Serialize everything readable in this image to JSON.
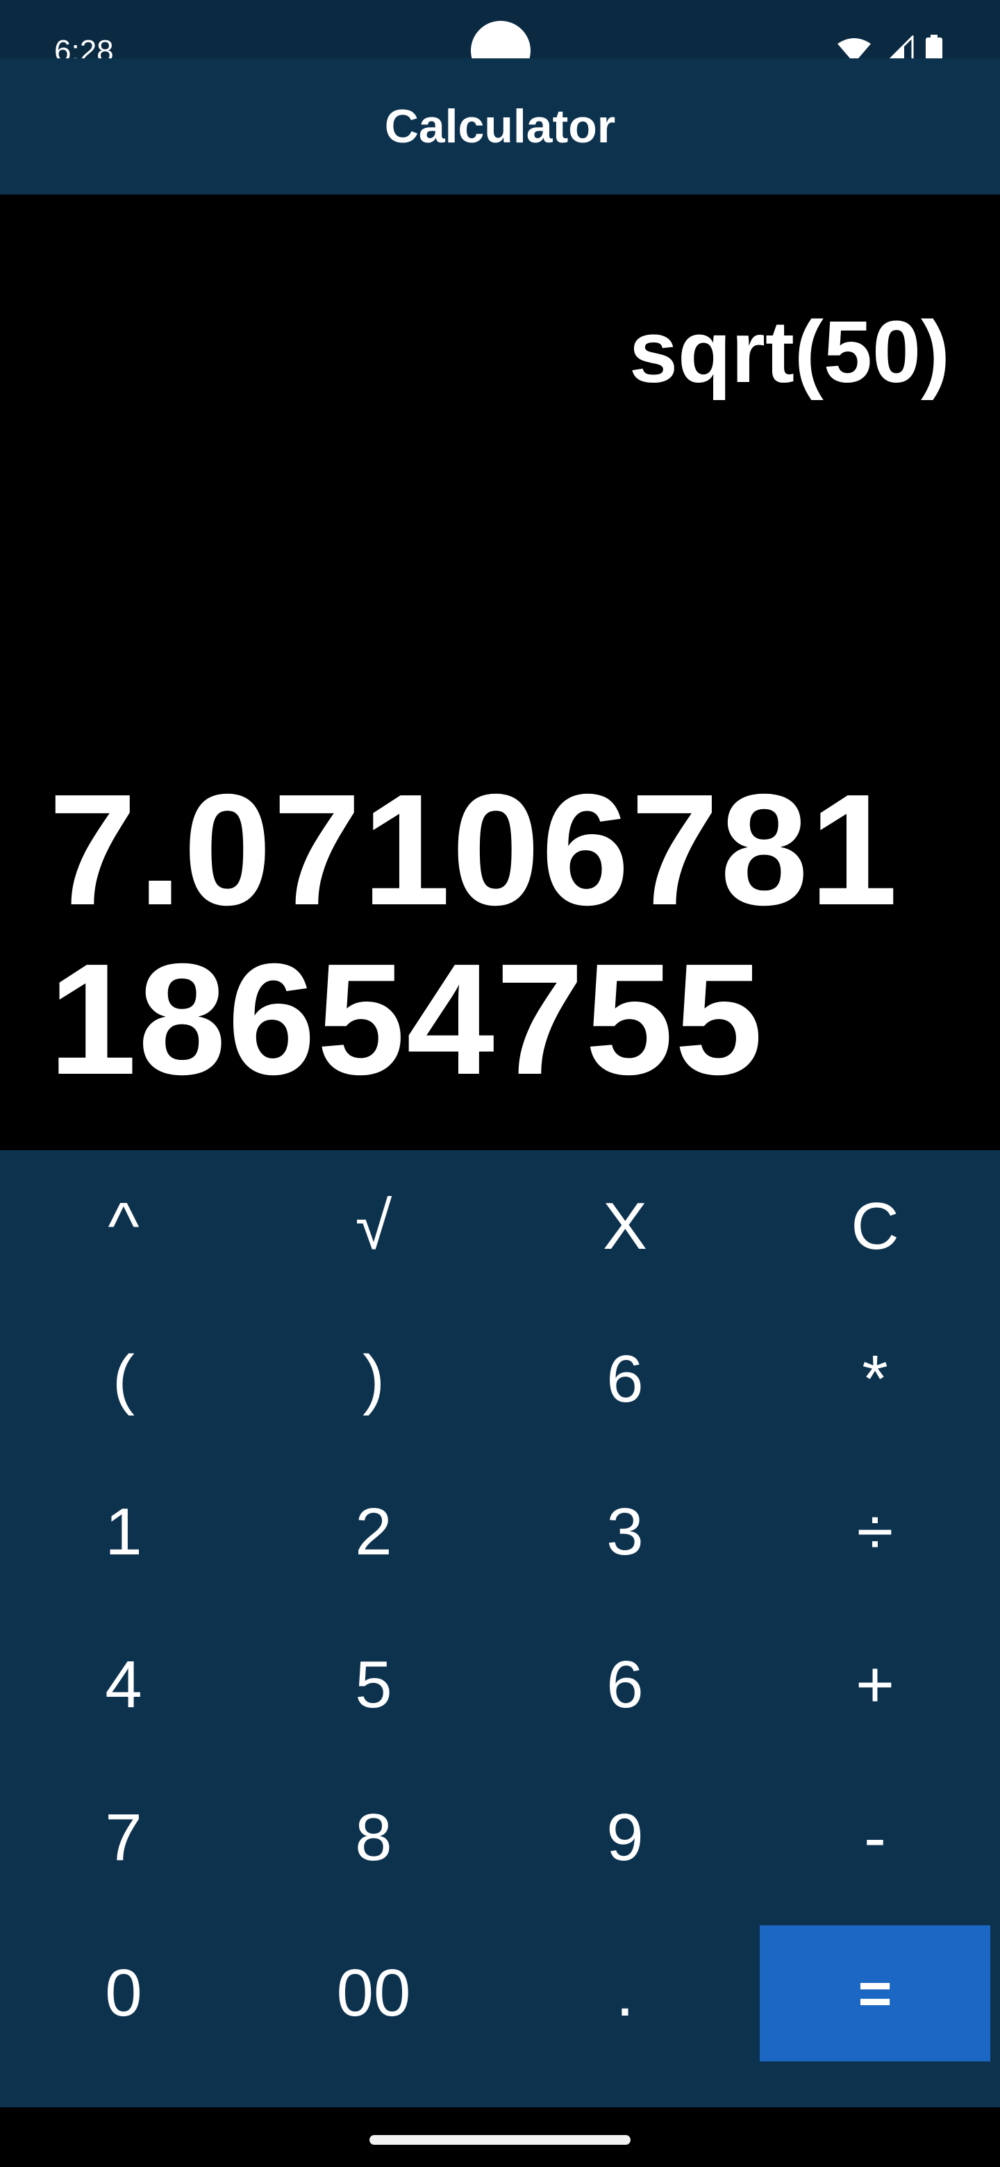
{
  "status_bar": {
    "time": "6:28",
    "icons": [
      "wifi-icon",
      "cell-signal-icon",
      "battery-icon"
    ]
  },
  "app_bar": {
    "title": "Calculator"
  },
  "display": {
    "expression": "sqrt(50)",
    "result": "7.0710678118654755"
  },
  "keypad": {
    "rows": [
      [
        "^",
        "√",
        "X",
        "C"
      ],
      [
        "(",
        ")",
        "6",
        "*"
      ],
      [
        "1",
        "2",
        "3",
        "÷"
      ],
      [
        "4",
        "5",
        "6",
        "+"
      ],
      [
        "7",
        "8",
        "9",
        "-"
      ],
      [
        "0",
        "00",
        ".",
        "="
      ]
    ]
  },
  "colors": {
    "status_bar_bg": "#0b2940",
    "app_bar_bg": "#0d324e",
    "keypad_bg": "#0d324e",
    "display_bg": "#000000",
    "equals_bg": "#1c66c4",
    "text": "#ffffff"
  }
}
